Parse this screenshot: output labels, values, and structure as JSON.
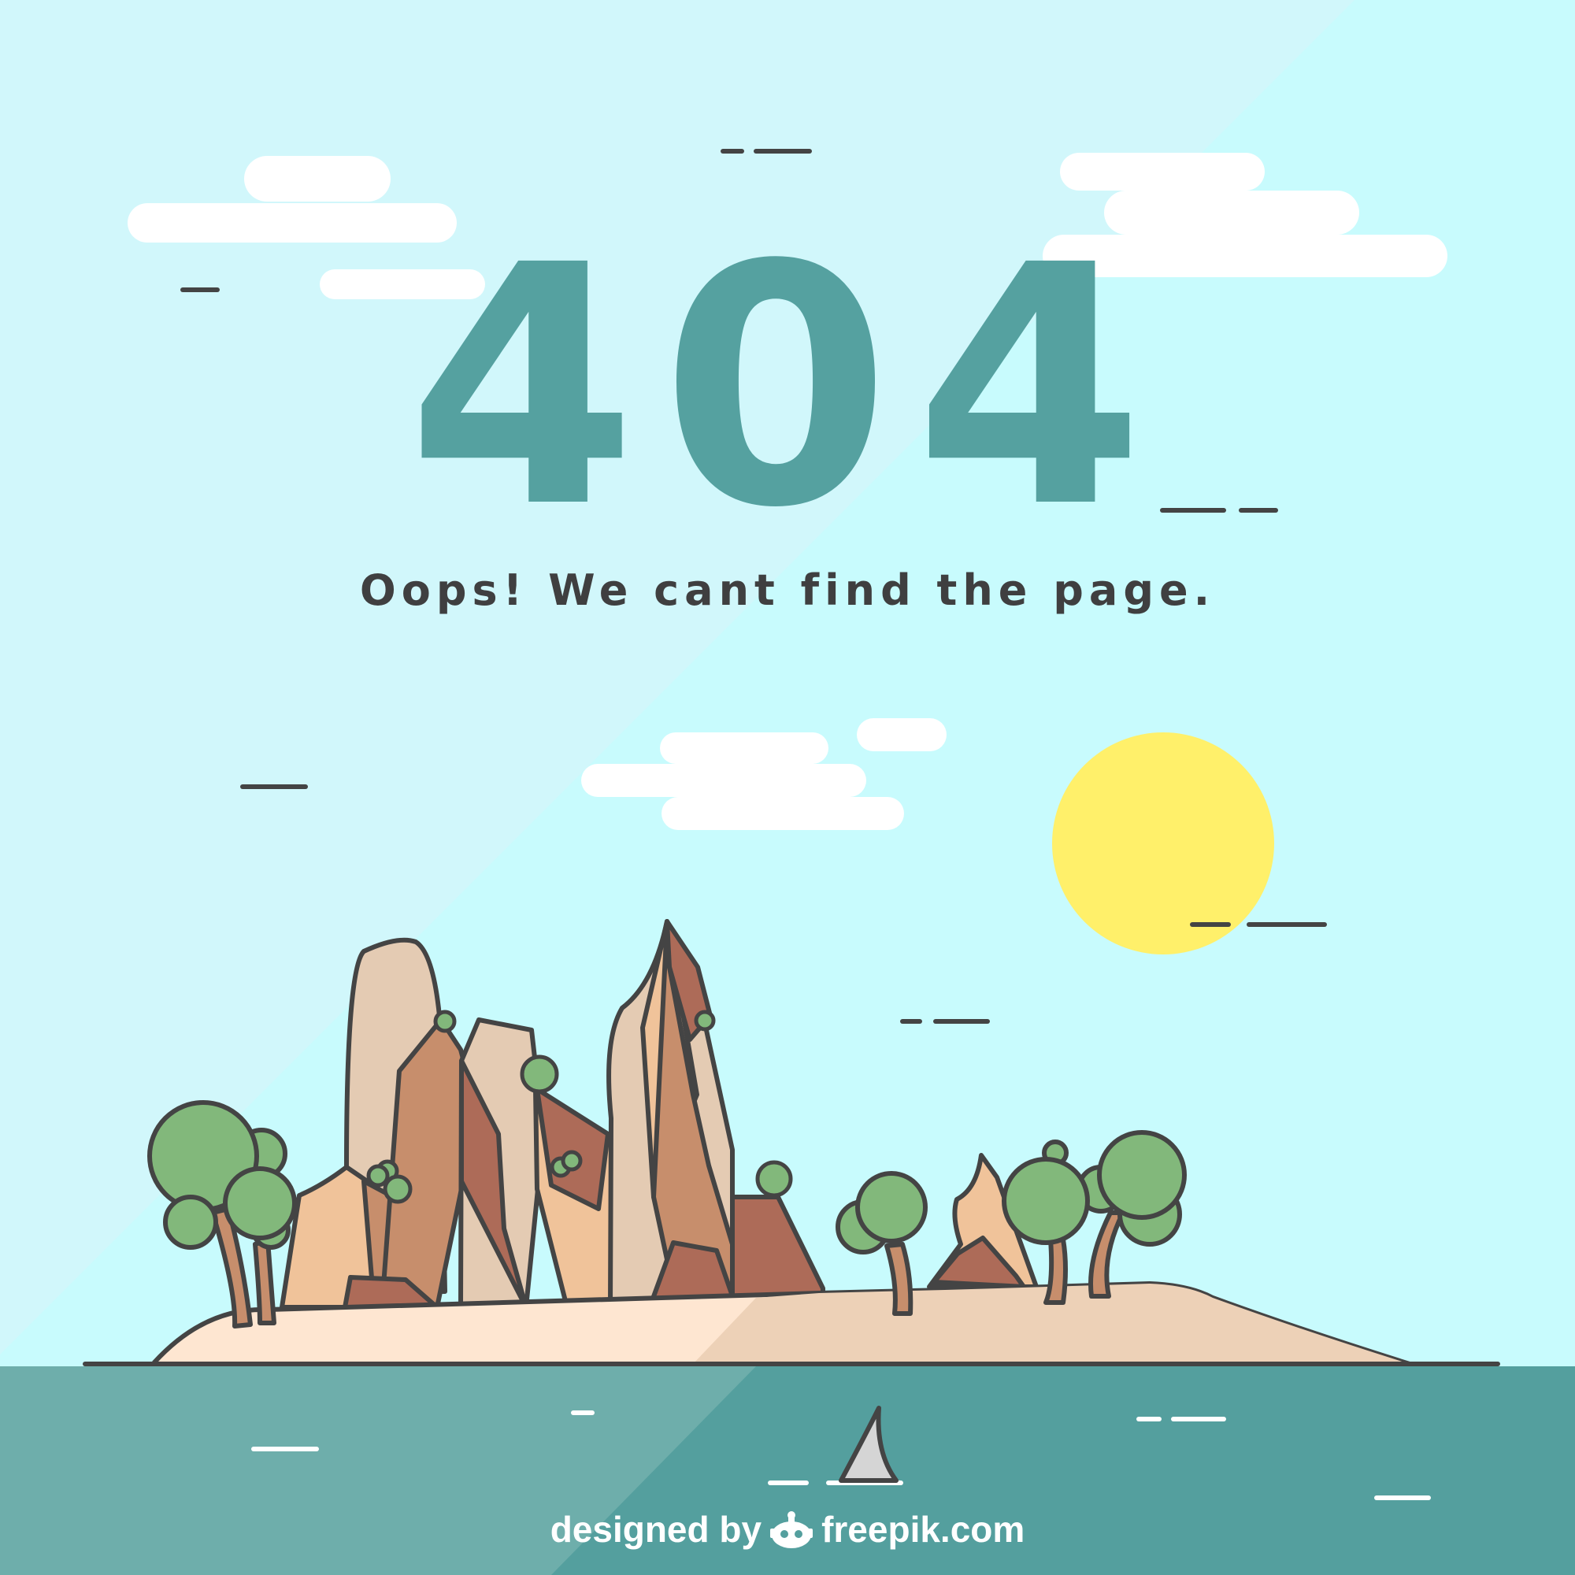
{
  "error": {
    "code": "404",
    "message": "Oops! We cant find the page."
  },
  "credit": {
    "prefix": "designed by",
    "brand": "freepik.com"
  },
  "icons": {
    "credit_logo": "freepik-logo-icon"
  },
  "colors": {
    "sky": "#c8fbfd",
    "code_text": "#55a1a0",
    "message_text": "#3f3f40",
    "sea": "#549f9e",
    "sun": "#fff06a",
    "cloud": "#ffffff",
    "sand": "#fee6d1",
    "tree_foliage": "#82b87b"
  }
}
